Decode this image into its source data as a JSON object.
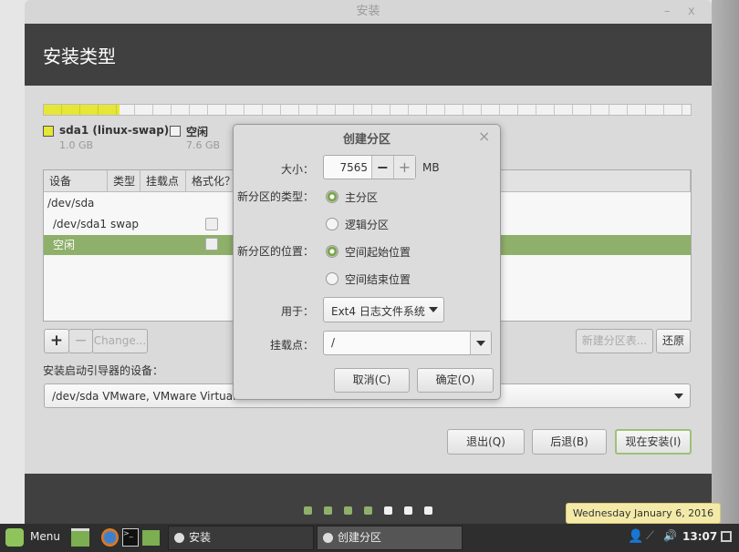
{
  "window": {
    "title": "安装",
    "minimize": "–",
    "close": "x",
    "header_title": "安装类型"
  },
  "disk_bar": {
    "used_fraction": 0.117,
    "used_color": "#e6e636"
  },
  "legend": [
    {
      "name": "sda1 (linux-swap)",
      "size": "1.0 GB",
      "color": "#e6e636"
    },
    {
      "name": "空闲",
      "size": "7.6 GB",
      "color": "#f2f2f2"
    }
  ],
  "table": {
    "headers": [
      "设备",
      "类型",
      "挂载点",
      "格式化？"
    ],
    "rows": [
      {
        "device": "/dev/sda",
        "type": "",
        "format": null
      },
      {
        "device": "/dev/sda1",
        "type": "swap",
        "format": false
      },
      {
        "device": "空闲",
        "type": "",
        "format": false,
        "selected": true
      }
    ]
  },
  "buttons": {
    "add": "+",
    "remove": "−",
    "change": "Change...",
    "new_table": "新建分区表...",
    "revert": "还原",
    "quit": "退出(Q)",
    "back": "后退(B)",
    "install": "现在安装(I)"
  },
  "bootloader": {
    "label": "安装启动引导器的设备：",
    "value": "/dev/sda   VMware, VMware Virtual"
  },
  "dialog": {
    "title": "创建分区",
    "close": "×",
    "size_label": "大小：",
    "size_value": "7565",
    "size_unit": "MB",
    "minus": "−",
    "plus": "+",
    "type_label": "新分区的类型：",
    "type_options": [
      "主分区",
      "逻辑分区"
    ],
    "type_selected": "主分区",
    "location_label": "新分区的位置：",
    "location_options": [
      "空间起始位置",
      "空间结束位置"
    ],
    "location_selected": "空间起始位置",
    "use_label": "用于：",
    "use_value": "Ext4 日志文件系统",
    "mount_label": "挂载点：",
    "mount_value": "/",
    "cancel": "取消(C)",
    "ok": "确定(O)"
  },
  "progress": {
    "total_steps": 7,
    "completed_steps": 4,
    "accent": "#8fb06a"
  },
  "taskbar": {
    "menu": "Menu",
    "tasks": [
      "安装",
      "创建分区"
    ],
    "clock": "13:07",
    "tooltip": "Wednesday January  6, 2016"
  },
  "accent": "#8fb06a"
}
